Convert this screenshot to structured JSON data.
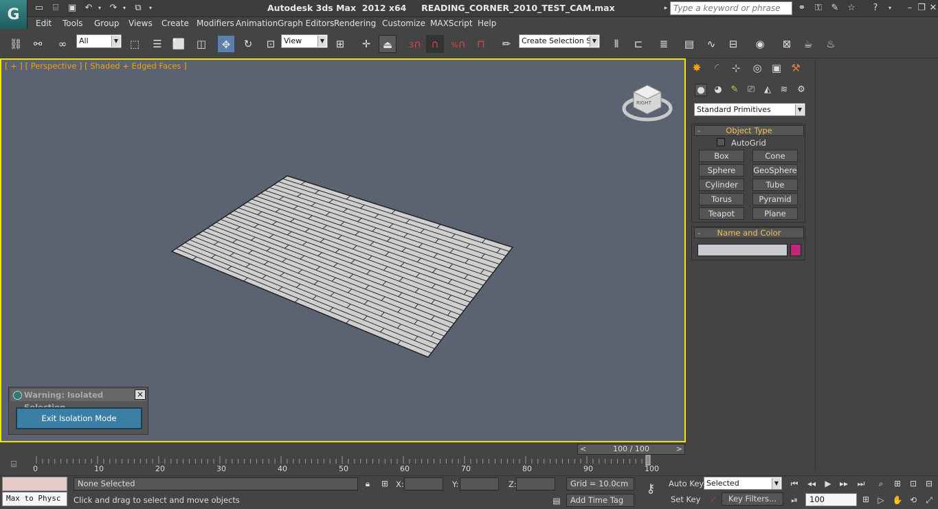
{
  "app": {
    "logo_text": "G",
    "title": "Autodesk 3ds Max  2012 x64     READING_CORNER_2010_TEST_CAM.max"
  },
  "search": {
    "placeholder": "Type a keyword or phrase"
  },
  "menus": [
    "Edit",
    "Tools",
    "Group",
    "Views",
    "Create",
    "Modifiers",
    "Animation",
    "Graph Editors",
    "Rendering",
    "Customize",
    "MAXScript",
    "Help"
  ],
  "toolbar": {
    "filter_value": "All",
    "refcoord_value": "View",
    "selection_set_value": "Create Selection Se",
    "snap_number": "3",
    "percent_symbol": "%"
  },
  "viewport": {
    "label": "[ + ] [ Perspective ] [ Shaded + Edged Faces ]",
    "viewcube_text": "RIGHT"
  },
  "command_panel": {
    "primitive_type": "Standard Primitives",
    "rollouts": {
      "object_type": "Object Type",
      "name_color": "Name and Color",
      "collapse_sign": "-"
    },
    "autogrid_label": "AutoGrid",
    "buttons": [
      "Box",
      "Cone",
      "Sphere",
      "GeoSphere",
      "Cylinder",
      "Tube",
      "Torus",
      "Pyramid",
      "Teapot",
      "Plane"
    ],
    "object_color": "#c0267a",
    "name_value": ""
  },
  "warning": {
    "title": "Warning: Isolated Selection",
    "close": "×",
    "button": "Exit Isolation Mode"
  },
  "timeline": {
    "current": 100,
    "total": 100,
    "slider_text": "100 / 100",
    "prev": "<",
    "next": ">",
    "ticks": [
      "0",
      "10",
      "20",
      "30",
      "40",
      "50",
      "60",
      "70",
      "80",
      "90",
      "100"
    ]
  },
  "status": {
    "script_text": "Max to Physc",
    "selection": "None Selected",
    "prompt": "Click and drag to select and move objects",
    "x_label": "X:",
    "y_label": "Y:",
    "z_label": "Z:",
    "grid": "Grid = 10.0cm",
    "add_time_tag": "Add Time Tag",
    "auto_key": "Auto Key",
    "set_key": "Set Key",
    "key_mode": "Selected",
    "key_filters": "Key Filters...",
    "frame": "100"
  }
}
